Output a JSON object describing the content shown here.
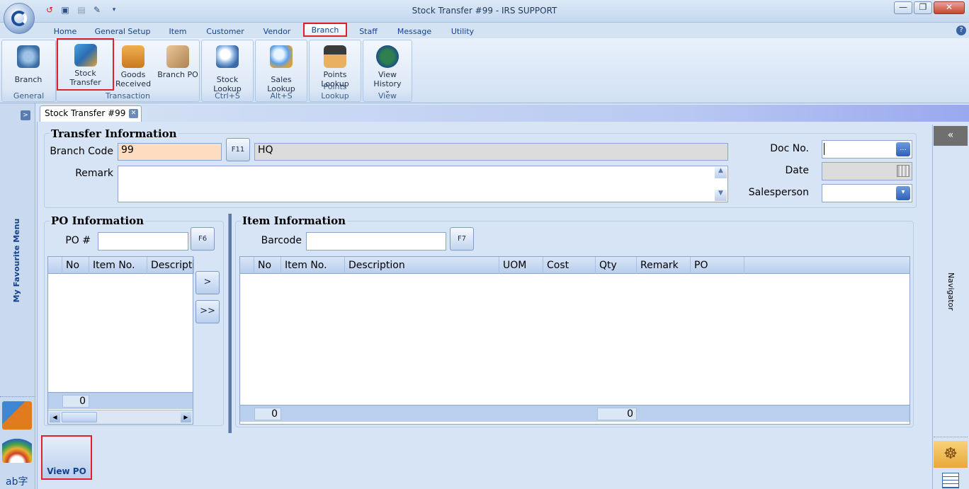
{
  "window": {
    "title": "Stock Transfer #99 - IRS SUPPORT",
    "minimize": "—",
    "maximize": "❐",
    "close": "✕"
  },
  "quick_access": [
    "undo-icon",
    "save-icon",
    "delete-icon",
    "tools-icon",
    "dropdown-icon"
  ],
  "menu_tabs": [
    "Home",
    "General Setup",
    "Item",
    "Customer",
    "Vendor",
    "Branch",
    "Staff",
    "Message",
    "Utility"
  ],
  "help": "?",
  "ribbon": {
    "groups": {
      "general": "General",
      "transaction": "Transaction",
      "stock_lookup": "Ctrl+S",
      "sales_lookup": "Alt+S",
      "points_lookup": "Points Lookup",
      "view": "View"
    },
    "buttons": {
      "branch": "Branch",
      "stock_transfer": "Stock Transfer",
      "goods_received": "Goods Received",
      "branch_po": "Branch PO",
      "stock_lookup": "Stock Lookup",
      "sales_lookup": "Sales Lookup",
      "points_lookup": "Points Lookup",
      "view_history": "View History",
      "view_history_arrow": "⌄"
    }
  },
  "sidebar": {
    "title": "My Favourite Menu",
    "toggle": ">"
  },
  "doc_tab": {
    "label": "Stock Transfer #99",
    "close": "✕"
  },
  "transfer": {
    "title": "Transfer Information",
    "branch_code_label": "Branch Code",
    "branch_code": "99",
    "branch_key": "F11",
    "branch_name": "HQ",
    "remark_label": "Remark",
    "doc_no_label": "Doc No.",
    "date_label": "Date",
    "salesperson_label": "Salesperson",
    "ellipsis": "...",
    "dropdown": "▾"
  },
  "po": {
    "title": "PO Information",
    "po_label": "PO #",
    "po_key": "F6",
    "columns": [
      "No",
      "Item No.",
      "Description"
    ],
    "footer_count": "0",
    "move_one": ">",
    "move_all": ">>"
  },
  "items": {
    "title": "Item Information",
    "barcode_label": "Barcode",
    "barcode_key": "F7",
    "columns": [
      "No",
      "Item No.",
      "Description",
      "UOM",
      "Cost",
      "Qty",
      "Remark",
      "PO"
    ],
    "footer_count": "0",
    "footer_qty": "0"
  },
  "navigator": {
    "title": "Navigator",
    "collapse": "«"
  },
  "actions": {
    "view_po": "View PO"
  }
}
